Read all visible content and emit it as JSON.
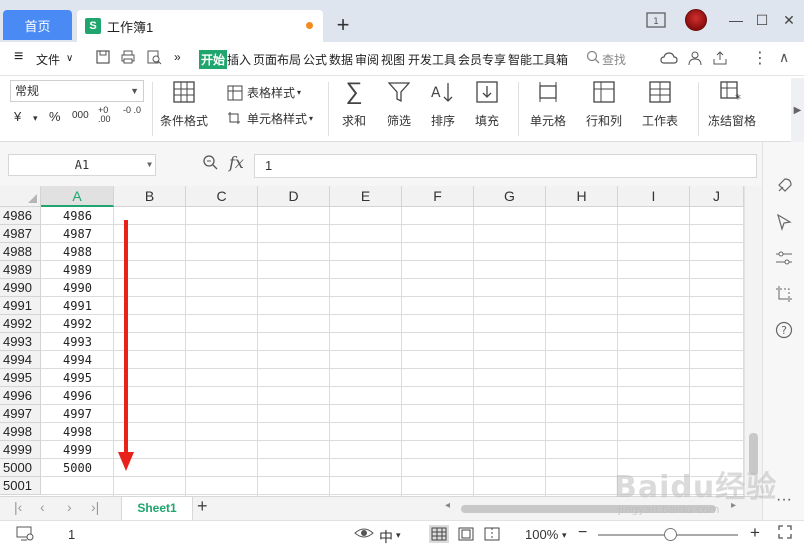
{
  "titlebar": {
    "home_tab": "首页",
    "doc_icon": "S",
    "doc_tab": "工作簿1",
    "add_tab": "+",
    "minimize": "—",
    "maximize": "☐",
    "close": "✕"
  },
  "menu": {
    "hamburger": "≡",
    "file": "文件",
    "file_arrow": "∨",
    "more": "»",
    "items": [
      "开始",
      "插入",
      "页面布局",
      "公式",
      "数据",
      "审阅",
      "视图",
      "开发工具",
      "会员专享",
      "智能工具箱"
    ],
    "search": "查找"
  },
  "ribbon": {
    "number_format": "常规",
    "yuan": "¥",
    "percent": "%",
    "thousands": "000",
    "inc_decimal": "+0 .00",
    "dec_decimal": "-0 .0",
    "cond_format": "条件格式",
    "table_style": "表格样式",
    "cell_style": "单元格样式",
    "sum": "求和",
    "filter": "筛选",
    "sort": "排序",
    "fill": "填充",
    "cell": "单元格",
    "row_col": "行和列",
    "sheet": "工作表",
    "freeze": "冻结窗格"
  },
  "formula": {
    "name_box": "A1",
    "fx": "fx",
    "value": "1"
  },
  "grid": {
    "columns": [
      "A",
      "B",
      "C",
      "D",
      "E",
      "F",
      "G",
      "H",
      "I",
      "J"
    ],
    "selected_column": "A",
    "rows": [
      "4986",
      "4987",
      "4988",
      "4989",
      "4990",
      "4991",
      "4992",
      "4993",
      "4994",
      "4995",
      "4996",
      "4997",
      "4998",
      "4999",
      "5000",
      "5001"
    ],
    "col_a_values": [
      "4986",
      "4987",
      "4988",
      "4989",
      "4990",
      "4991",
      "4992",
      "4993",
      "4994",
      "4995",
      "4996",
      "4997",
      "4998",
      "4999",
      "5000",
      ""
    ]
  },
  "sheets": {
    "active": "Sheet1",
    "add": "+"
  },
  "status": {
    "page": "1",
    "zoom": "100%",
    "minus": "−",
    "plus": "+"
  },
  "watermark": {
    "text": "Baidu经验",
    "sub": "jingyan.baidu.com"
  },
  "colors": {
    "accent_green": "#1fa56d",
    "home_tab_blue": "#4a8af4",
    "arrow_red": "#e8221b"
  }
}
